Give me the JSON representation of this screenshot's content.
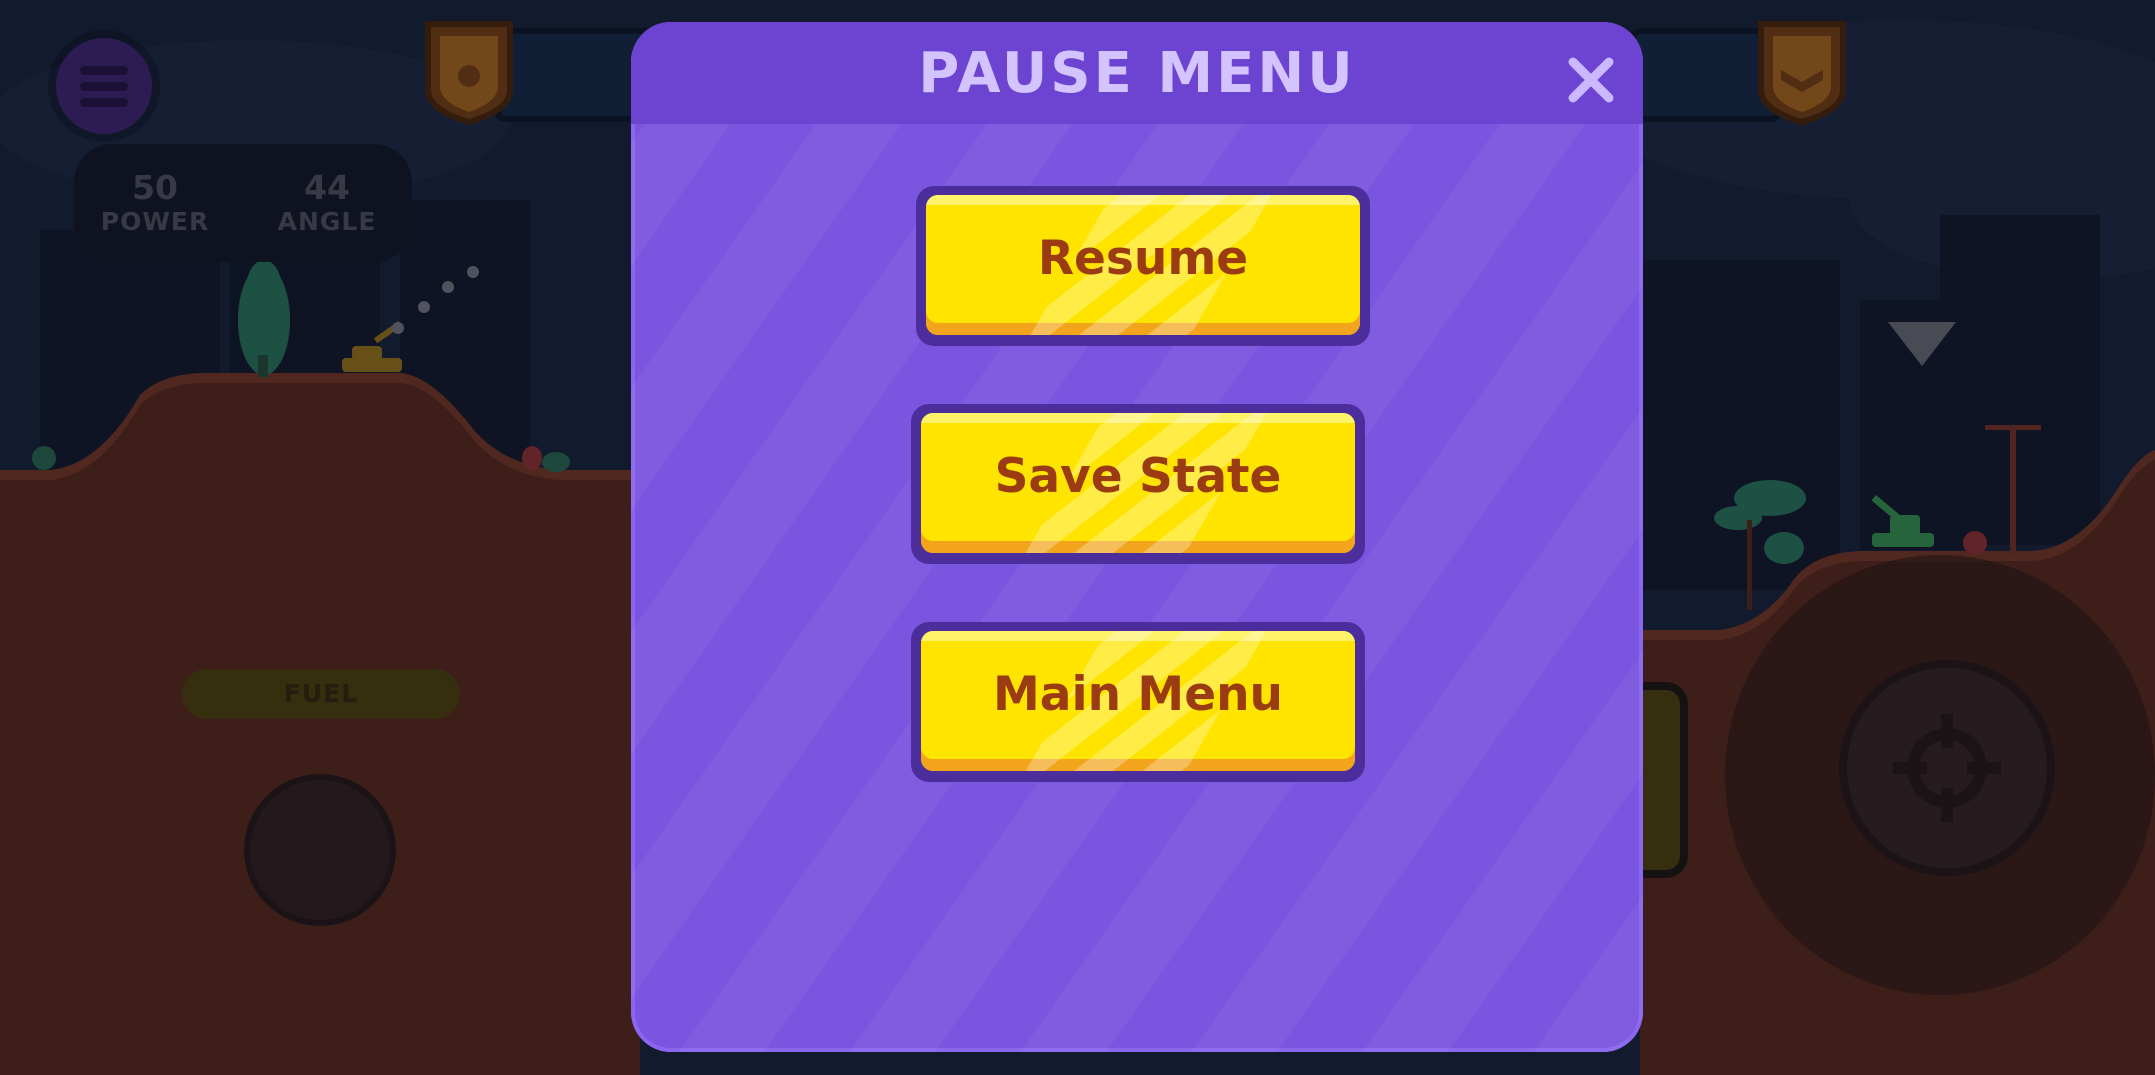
{
  "hud": {
    "power_value": "50",
    "power_label": "POWER",
    "angle_value": "44",
    "angle_label": "ANGLE",
    "fuel_label": "FUEL"
  },
  "pause_menu": {
    "title": "PAUSE MENU",
    "buttons": [
      {
        "label": "Resume"
      },
      {
        "label": "Save State"
      },
      {
        "label": "Main Menu"
      }
    ],
    "close_icon": "close-icon"
  },
  "icons": {
    "menu": "hamburger-menu-icon",
    "shield_left": "rank-shield-icon",
    "shield_right": "rank-shield-icon",
    "marker": "target-marker-triangle-icon",
    "fire": "crosshair-icon"
  },
  "colors": {
    "modal_bg": "#7a55e0",
    "modal_header": "#6d44d2",
    "button_yellow": "#ffe400",
    "button_text": "#9a3b12",
    "title_text": "#d3c3ff"
  }
}
